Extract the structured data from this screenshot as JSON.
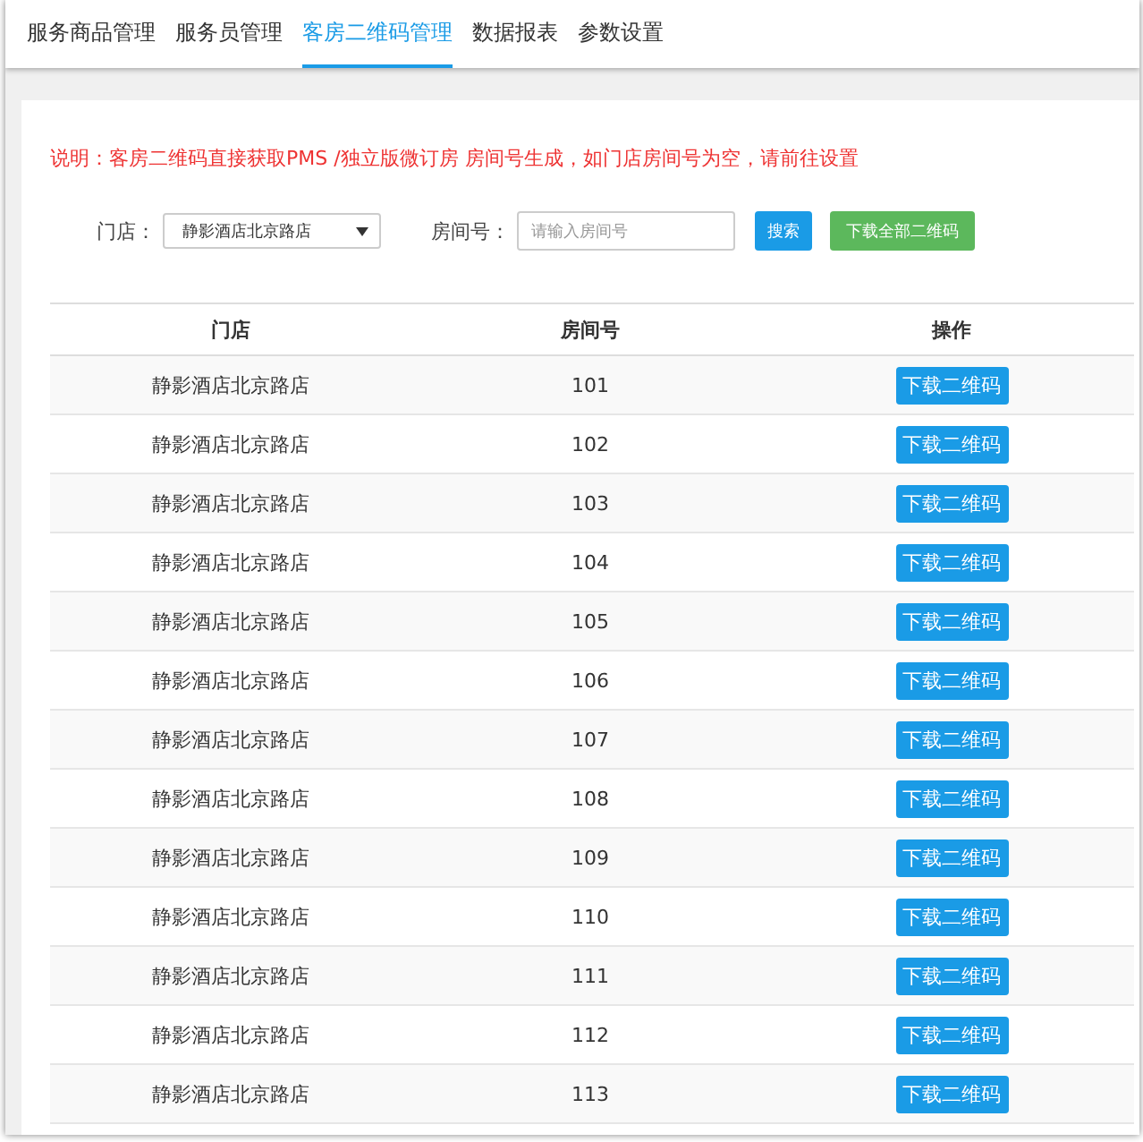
{
  "tabs": [
    {
      "label": "服务商品管理",
      "selected": false
    },
    {
      "label": "服务员管理",
      "selected": false
    },
    {
      "label": "客房二维码管理",
      "selected": true
    },
    {
      "label": "数据报表",
      "selected": false
    },
    {
      "label": "参数设置",
      "selected": false
    }
  ],
  "notice": "说明：客房二维码直接获取PMS /独立版微订房  房间号生成，如门店房间号为空，请前往设置",
  "filters": {
    "store_label": "门店：",
    "store_value": "静影酒店北京路店",
    "room_label": "房间号：",
    "room_placeholder": "请输入房间号",
    "search_button": "搜索",
    "download_all_button": "下载全部二维码"
  },
  "table": {
    "columns": [
      "门店",
      "房间号",
      "操作"
    ],
    "rows": [
      {
        "store": "静影酒店北京路店",
        "room": "101",
        "action": "下载二维码"
      },
      {
        "store": "静影酒店北京路店",
        "room": "102",
        "action": "下载二维码"
      },
      {
        "store": "静影酒店北京路店",
        "room": "103",
        "action": "下载二维码"
      },
      {
        "store": "静影酒店北京路店",
        "room": "104",
        "action": "下载二维码"
      },
      {
        "store": "静影酒店北京路店",
        "room": "105",
        "action": "下载二维码"
      },
      {
        "store": "静影酒店北京路店",
        "room": "106",
        "action": "下载二维码"
      },
      {
        "store": "静影酒店北京路店",
        "room": "107",
        "action": "下载二维码"
      },
      {
        "store": "静影酒店北京路店",
        "room": "108",
        "action": "下载二维码"
      },
      {
        "store": "静影酒店北京路店",
        "room": "109",
        "action": "下载二维码"
      },
      {
        "store": "静影酒店北京路店",
        "room": "110",
        "action": "下载二维码"
      },
      {
        "store": "静影酒店北京路店",
        "room": "111",
        "action": "下载二维码"
      },
      {
        "store": "静影酒店北京路店",
        "room": "112",
        "action": "下载二维码"
      },
      {
        "store": "静影酒店北京路店",
        "room": "113",
        "action": "下载二维码"
      }
    ]
  }
}
